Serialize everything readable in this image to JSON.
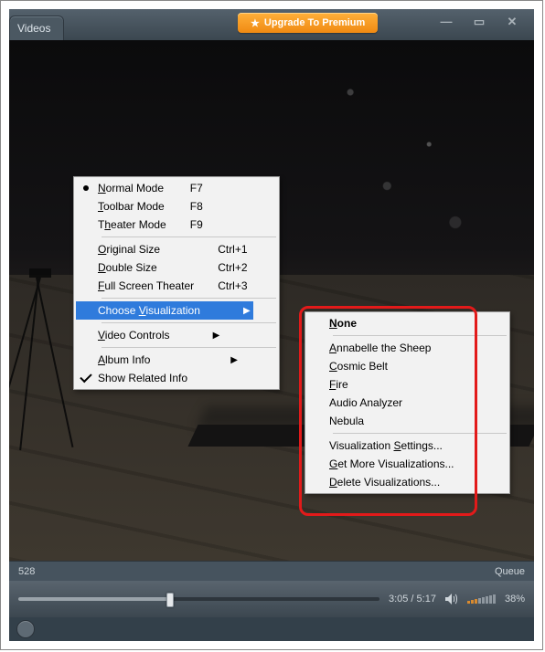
{
  "titlebar": {
    "tab_label": "Videos",
    "upgrade_label": "Upgrade To Premium",
    "upgrade_star": "★",
    "min_glyph": "—",
    "max_glyph": "▭",
    "close_glyph": "✕"
  },
  "info_bar": {
    "left_text": "528",
    "right_text": "Queue"
  },
  "controls": {
    "time_elapsed": "3:05",
    "time_separator": " / ",
    "time_total": "5:17",
    "volume_pct": "38%"
  },
  "context_menu": {
    "items": [
      {
        "type": "item",
        "label": "Normal Mode",
        "ul": "N",
        "accel": "F7",
        "radio": true
      },
      {
        "type": "item",
        "label": "Toolbar Mode",
        "ul": "T",
        "accel": "F8"
      },
      {
        "type": "item",
        "label": "Theater Mode",
        "ul": "h",
        "accel": "F9"
      },
      {
        "type": "sep"
      },
      {
        "type": "item",
        "label": "Original Size",
        "ul": "O",
        "accel": "Ctrl+1"
      },
      {
        "type": "item",
        "label": "Double Size",
        "ul": "D",
        "accel": "Ctrl+2"
      },
      {
        "type": "item",
        "label": "Full Screen Theater",
        "ul": "F",
        "accel": "Ctrl+3"
      },
      {
        "type": "sep"
      },
      {
        "type": "item",
        "label": "Choose Visualization",
        "ul": "V",
        "submenu": true,
        "highlight": true
      },
      {
        "type": "sep"
      },
      {
        "type": "item",
        "label": "Video Controls",
        "ul": "V",
        "submenu": true
      },
      {
        "type": "sep"
      },
      {
        "type": "item",
        "label": "Album Info",
        "ul": "A",
        "submenu": true
      },
      {
        "type": "item",
        "label": "Show Related Info",
        "checked": true
      }
    ]
  },
  "submenu_visualization": {
    "items": [
      {
        "type": "item",
        "label": "None",
        "ul": "N",
        "bold": true
      },
      {
        "type": "sep"
      },
      {
        "type": "item",
        "label": "Annabelle the Sheep",
        "ul": "A"
      },
      {
        "type": "item",
        "label": "Cosmic Belt",
        "ul": "C"
      },
      {
        "type": "item",
        "label": "Fire",
        "ul": "F"
      },
      {
        "type": "item",
        "label": "Audio Analyzer"
      },
      {
        "type": "item",
        "label": "Nebula"
      },
      {
        "type": "sep"
      },
      {
        "type": "item",
        "label": "Visualization Settings...",
        "ul": "S"
      },
      {
        "type": "item",
        "label": "Get More Visualizations...",
        "ul": "G"
      },
      {
        "type": "item",
        "label": "Delete Visualizations...",
        "ul": "D"
      }
    ]
  }
}
